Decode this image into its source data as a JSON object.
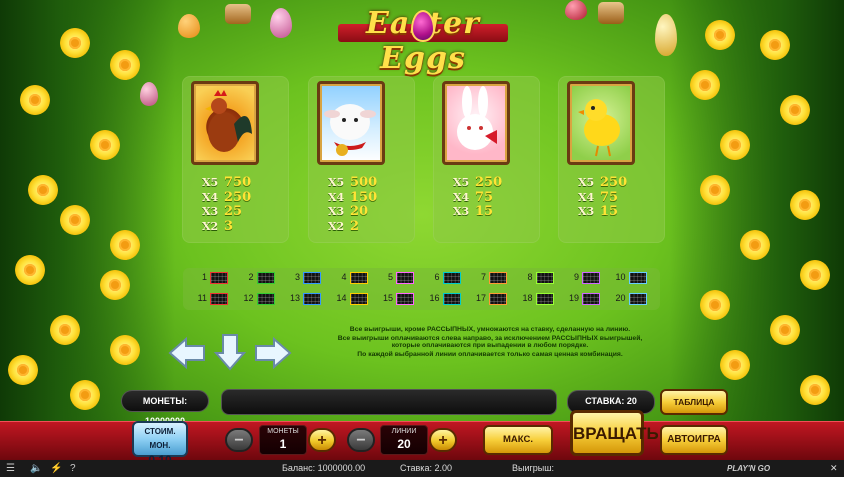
{
  "logo": {
    "text": "Easter Eggs"
  },
  "paytable": [
    {
      "symbol": "rooster",
      "colors": [
        "#f3a629",
        "#8a3a0c"
      ],
      "payouts": [
        {
          "x": "X5",
          "v": "750"
        },
        {
          "x": "X4",
          "v": "250"
        },
        {
          "x": "X3",
          "v": "25"
        },
        {
          "x": "X2",
          "v": "3"
        }
      ]
    },
    {
      "symbol": "lamb",
      "colors": [
        "#9fd4ff",
        "#f7f7f7"
      ],
      "payouts": [
        {
          "x": "X5",
          "v": "500"
        },
        {
          "x": "X4",
          "v": "150"
        },
        {
          "x": "X3",
          "v": "20"
        },
        {
          "x": "X2",
          "v": "2"
        }
      ]
    },
    {
      "symbol": "bunny",
      "colors": [
        "#ffb9c8",
        "#ffffff"
      ],
      "payouts": [
        {
          "x": "X5",
          "v": "250"
        },
        {
          "x": "X4",
          "v": "75"
        },
        {
          "x": "X3",
          "v": "15"
        }
      ]
    },
    {
      "symbol": "chick",
      "colors": [
        "#a7d95a",
        "#ffd21a"
      ],
      "payouts": [
        {
          "x": "X5",
          "v": "250"
        },
        {
          "x": "X4",
          "v": "75"
        },
        {
          "x": "X3",
          "v": "15"
        }
      ]
    }
  ],
  "paylines": [
    "1",
    "2",
    "3",
    "4",
    "5",
    "6",
    "7",
    "8",
    "9",
    "10",
    "11",
    "12",
    "13",
    "14",
    "15",
    "16",
    "17",
    "18",
    "19",
    "20"
  ],
  "rules": [
    "Все выигрыши, кроме РАССЫПНЫХ, умножаются на ставку, сделанную на линию.",
    "Все выигрыши оплачиваются слева направо, за исключением РАССЫПНЫХ выигрышей, которые оплачиваются при выпадении в любом порядке.",
    "По каждой выбранной линии оплачивается только самая ценная комбинация."
  ],
  "controls": {
    "coins_label": "МОНЕТЫ: 10000000",
    "bet_label": "СТАВКА: 20",
    "paytable_button": "ТАБЛИЦА ВЫПЛАТ",
    "coin_value_label": "СТОИМ. МОН.",
    "coin_value": "0.10",
    "coins_counter_label": "МОНЕТЫ",
    "coins_counter_value": "1",
    "lines_counter_label": "ЛИНИИ",
    "lines_counter_value": "20",
    "max_bet_button": "МАКС. СТАВКА",
    "spin_button": "ВРАЩАТЬ",
    "autoplay_button": "АВТОИГРА",
    "minus": "−",
    "plus": "+"
  },
  "status": {
    "balance": "Баланс: 1000000.00",
    "bet": "Ставка: 2.00",
    "win": "Выигрыш:",
    "brand": "PLAY'N GO",
    "close": "✕"
  }
}
